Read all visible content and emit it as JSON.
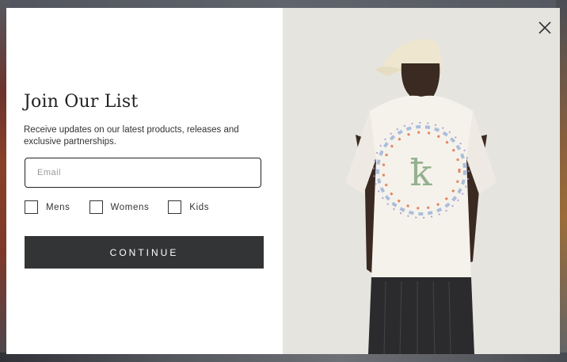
{
  "popup": {
    "title": "Join Our List",
    "subtitle": "Receive updates on our latest products, releases and exclusive partnerships.",
    "email": {
      "value": "",
      "placeholder": "Email"
    },
    "preferences": [
      {
        "label": "Mens",
        "checked": false
      },
      {
        "label": "Womens",
        "checked": false
      },
      {
        "label": "Kids",
        "checked": false
      }
    ],
    "continue_label": "CONTINUE",
    "close_icon": "close-icon",
    "image_alt_icon": "model-photo"
  },
  "colors": {
    "button_bg": "#333436",
    "text": "#222222",
    "photo_bg": "#e6e4df"
  }
}
